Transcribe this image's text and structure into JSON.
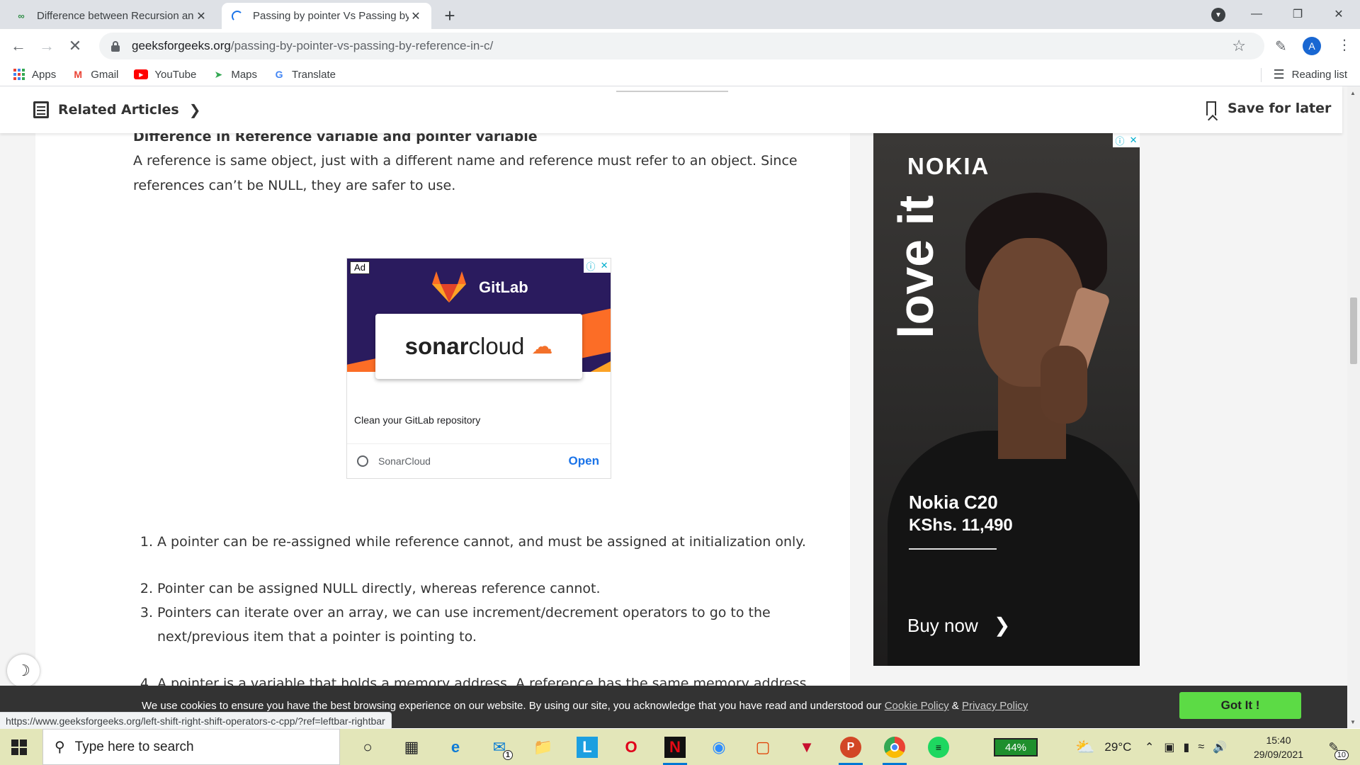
{
  "browser": {
    "tabs": [
      {
        "title": "Difference between Recursion an",
        "active": false
      },
      {
        "title": "Passing by pointer Vs Passing by",
        "active": true
      }
    ],
    "url_host": "geeksforgeeks.org",
    "url_path": "/passing-by-pointer-vs-passing-by-reference-in-c/",
    "profile_initial": "A",
    "bookmarks": [
      "Apps",
      "Gmail",
      "YouTube",
      "Maps",
      "Translate"
    ],
    "reading_list": "Reading list",
    "status_url": "https://www.geeksforgeeks.org/left-shift-right-shift-operators-c-cpp/?ref=leftbar-rightbar"
  },
  "page": {
    "related_articles": "Related Articles",
    "save_for_later": "Save for later",
    "subheading": "Difference in Reference variable and pointer variable",
    "paragraph": "A reference is same object, just with a different name and reference must refer to an object. Since references can’t be NULL, they are safer to use.",
    "list": [
      {
        "num": "1.",
        "text": "A pointer can be re-assigned while reference cannot, and must be assigned at initialization only."
      },
      {
        "num": "2.",
        "text": "Pointer can be assigned NULL directly, whereas reference cannot."
      },
      {
        "num": "3.",
        "text": "Pointers can iterate over an array, we can use increment/decrement operators to go to the next/previous item that a pointer is pointing to."
      },
      {
        "num": "4.",
        "text": "A pointer is a variable that holds a memory address. A reference has the same memory address as"
      }
    ]
  },
  "ad_gitlab": {
    "ad_label": "Ad",
    "brand": "GitLab",
    "product_a": "sonar",
    "product_b": "cloud",
    "tagline": "Clean your GitLab repository",
    "advertiser": "SonarCloud",
    "cta": "Open"
  },
  "ad_nokia": {
    "brand": "NOKIA",
    "slogan": "love it",
    "model": "Nokia C20",
    "price": "KShs. 11,490",
    "cta": "Buy now"
  },
  "cookie": {
    "message": "We use cookies to ensure you have the best browsing experience on our website. By using our site, you acknowledge that you have read and understood our ",
    "cookie_policy": "Cookie Policy",
    "amp": " & ",
    "privacy_policy": "Privacy Policy",
    "button": "Got It !"
  },
  "taskbar": {
    "search_placeholder": "Type here to search",
    "battery": "44%",
    "temperature": "29°C",
    "time": "15:40",
    "date": "29/09/2021",
    "notifications": "10",
    "mail_badge": "1"
  }
}
